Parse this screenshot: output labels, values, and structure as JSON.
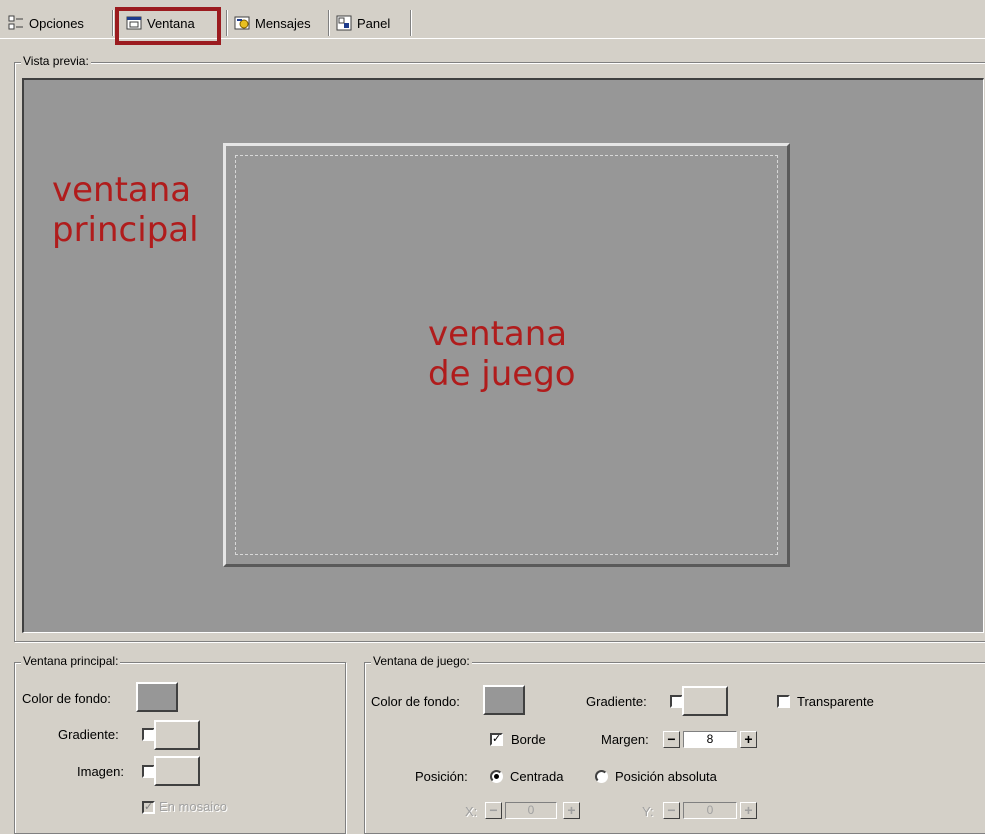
{
  "tabs": [
    {
      "label": "Opciones",
      "icon": "options-icon"
    },
    {
      "label": "Ventana",
      "icon": "window-icon"
    },
    {
      "label": "Mensajes",
      "icon": "messages-icon"
    },
    {
      "label": "Panel",
      "icon": "panel-icon"
    }
  ],
  "active_tab": "Ventana",
  "highlight_color": "#9b1b1f",
  "preview": {
    "legend": "Vista previa:",
    "main_window_label_line1": "ventana",
    "main_window_label_line2": "principal",
    "game_window_label_line1": "ventana",
    "game_window_label_line2": "de juego",
    "background_color": "#979797",
    "annotation_color": "#b01c1c"
  },
  "main_window": {
    "legend": "Ventana principal:",
    "bg_color_label": "Color de fondo:",
    "gradient_label": "Gradiente:",
    "image_label": "Imagen:",
    "tile_label": "En mosaico",
    "tile_checked": true,
    "tile_enabled": false
  },
  "game_window": {
    "legend": "Ventana de juego:",
    "bg_color_label": "Color de fondo:",
    "gradient_label": "Gradiente:",
    "transparent_label": "Transparente",
    "border_label": "Borde",
    "border_checked": true,
    "margin_label": "Margen:",
    "margin_value": "8",
    "position_label": "Posición:",
    "centered_label": "Centrada",
    "absolute_label": "Posición absoluta",
    "position_selected": "Centrada",
    "x_label": "X:",
    "x_value": "0",
    "y_label": "Y:",
    "y_value": "0"
  }
}
